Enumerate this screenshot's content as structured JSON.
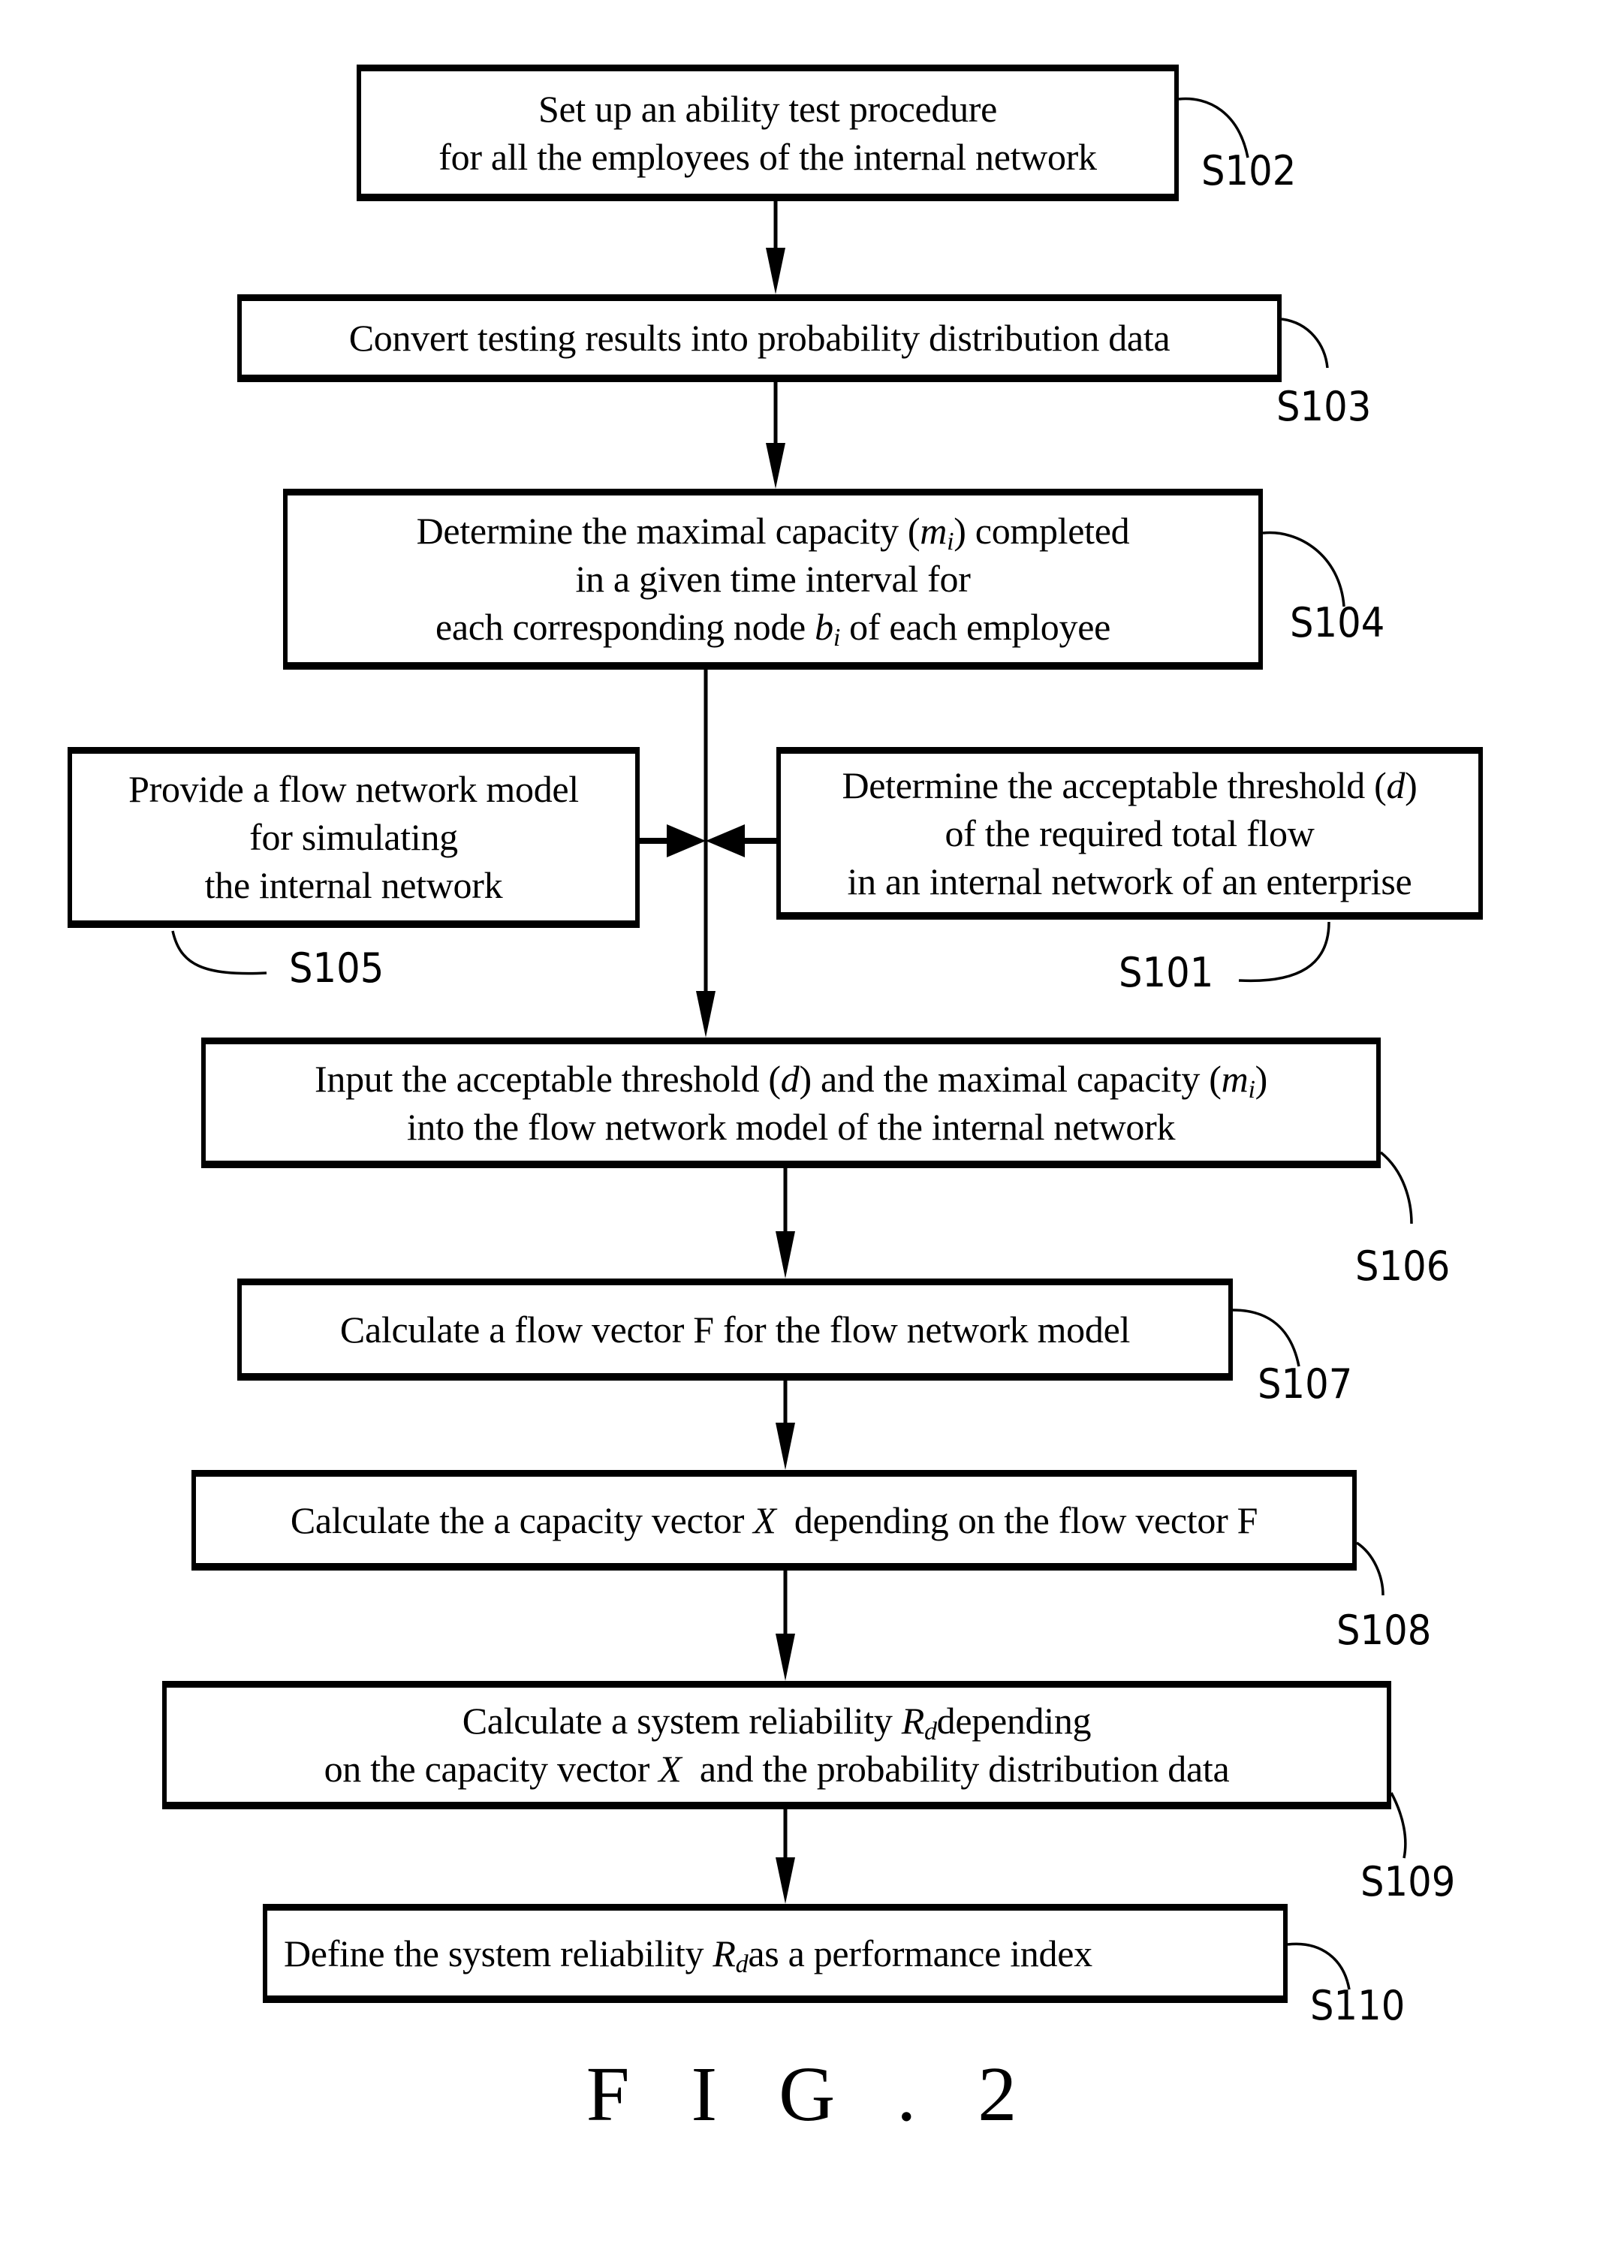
{
  "figure_label": "F I G . 2",
  "steps": {
    "s102": {
      "id": "S102",
      "lines": [
        "Set up an ability test procedure",
        "for all the employees of the internal network"
      ]
    },
    "s103": {
      "id": "S103",
      "lines": [
        "Convert testing results into probability distribution data"
      ]
    },
    "s104": {
      "id": "S104",
      "line1_pre": "Determine the maximal capacity (",
      "line1_var": "m",
      "line1_sub": "i",
      "line1_post": ") completed",
      "line2": "in a given time interval for",
      "line3_pre": "each corresponding node ",
      "line3_var": "b",
      "line3_sub": "i",
      "line3_post": " of each employee"
    },
    "s105": {
      "id": "S105",
      "lines": [
        "Provide a flow network model",
        "for simulating",
        "the internal network"
      ]
    },
    "s101": {
      "id": "S101",
      "line1_pre": "Determine the acceptable threshold (",
      "line1_var": "d",
      "line1_post": ")",
      "line2": "of the required total flow",
      "line3": "in an internal network of an enterprise"
    },
    "s106": {
      "id": "S106",
      "line1_pre": "Input the acceptable threshold (",
      "line1_var1": "d",
      "line1_mid": ") and the maximal capacity (",
      "line1_var2": "m",
      "line1_sub": "i",
      "line1_post": ")",
      "line2": "into the flow network model of the internal network"
    },
    "s107": {
      "id": "S107",
      "lines": [
        "Calculate a flow vector F for the flow network model"
      ]
    },
    "s108": {
      "id": "S108",
      "line1_pre": "Calculate the a capacity vector ",
      "line1_var": "X",
      "line1_post": "  depending on the flow vector F"
    },
    "s109": {
      "id": "S109",
      "line1_pre": "Calculate a system reliability ",
      "line1_var": "R",
      "line1_sub": "d",
      "line1_post": "depending",
      "line2_pre": "on the capacity vector ",
      "line2_var": "X",
      "line2_post": "  and the probability distribution data"
    },
    "s110": {
      "id": "S110",
      "line1_pre": "Define the system reliability ",
      "line1_var": "R",
      "line1_sub": "d",
      "line1_post": "as a performance index"
    }
  }
}
